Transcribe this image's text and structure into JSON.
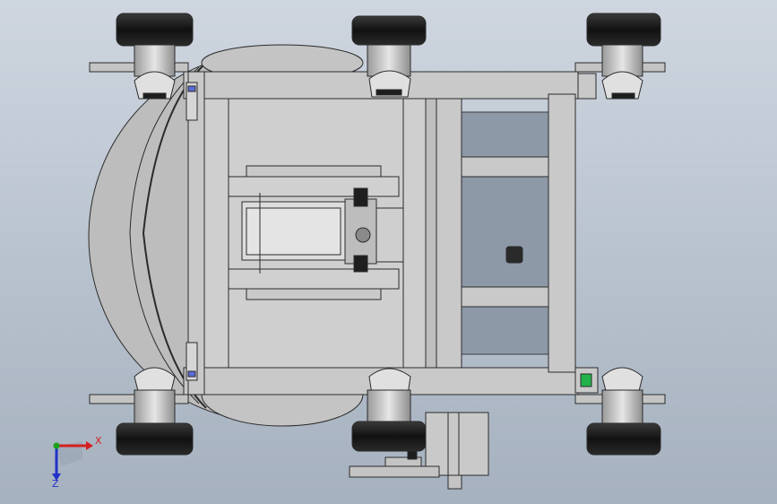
{
  "view": {
    "background_top": "#cfd6e0",
    "background_bottom": "#a6b1bf"
  },
  "triad": {
    "x_label": "X",
    "z_label": "Z",
    "x_color": "#d42020",
    "y_color": "#1aa31a",
    "z_color": "#2030c8"
  },
  "model": {
    "part_color": "#c9c9c9",
    "edge_color": "#2b2b2b",
    "wheel_color": "#1e1e1e",
    "indicator_color": "#21b34a"
  }
}
